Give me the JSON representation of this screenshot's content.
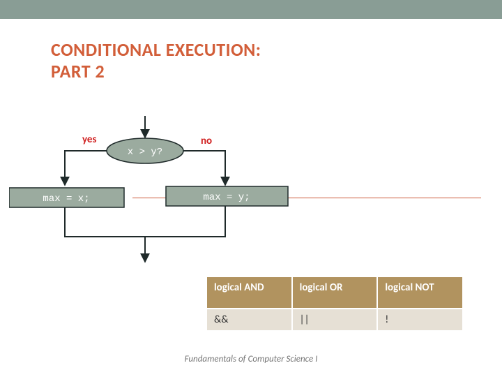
{
  "title": {
    "line1": "CONDITIONAL EXECUTION:",
    "line2": "PART 2"
  },
  "flowchart": {
    "decision": "x > y?",
    "yes_label": "yes",
    "no_label": "no",
    "left_action": "max = x;",
    "right_action": "max = y;"
  },
  "table": {
    "headers": [
      "logical AND",
      "logical OR",
      "logical NOT"
    ],
    "row": [
      "&&",
      "||",
      "!"
    ]
  },
  "footer": "Fundamentals of Computer Science I",
  "colors": {
    "accent": "#d25e39",
    "shape_fill": "#9bab9f",
    "table_header": "#b1935f"
  }
}
